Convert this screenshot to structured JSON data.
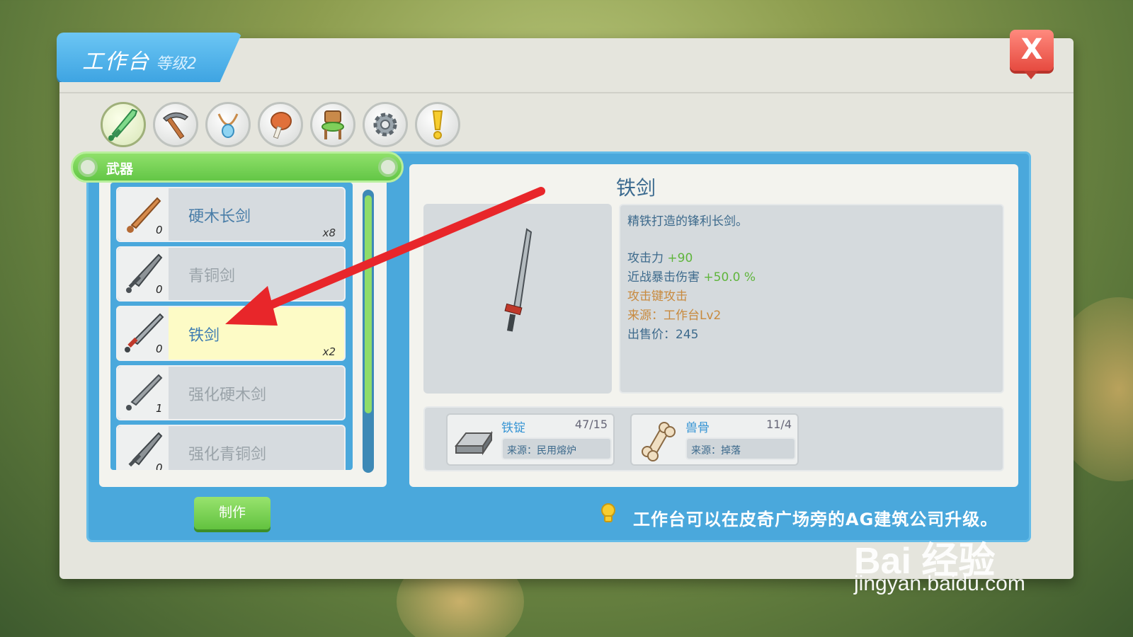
{
  "title": {
    "main": "工作台",
    "level": "等级2"
  },
  "close_label": "X",
  "categories": [
    "sword-icon",
    "pickaxe-icon",
    "necklace-icon",
    "meat-icon",
    "chair-icon",
    "gear-icon",
    "exclamation-icon"
  ],
  "category_bar": {
    "label": "武器"
  },
  "items": [
    {
      "name": "硬木长剑",
      "count": "0",
      "qty": "x8",
      "state": "normal"
    },
    {
      "name": "青铜剑",
      "count": "0",
      "qty": "",
      "state": "dim"
    },
    {
      "name": "铁剑",
      "count": "0",
      "qty": "x2",
      "state": "selected"
    },
    {
      "name": "强化硬木剑",
      "count": "1",
      "qty": "",
      "state": "dim"
    },
    {
      "name": "强化青铜剑",
      "count": "0",
      "qty": "",
      "state": "dim"
    }
  ],
  "make_button": "制作",
  "detail": {
    "name": "铁剑",
    "description": "精铁打造的锋利长剑。",
    "attack_label": "攻击力",
    "attack_value": "+90",
    "crit_label": "近战暴击伤害",
    "crit_value": "+50.0 %",
    "attack_key": "攻击键攻击",
    "source": "来源：工作台Lv2",
    "price": "出售价：245"
  },
  "materials": [
    {
      "name": "铁锭",
      "count": "47/15",
      "source": "来源：民用熔炉",
      "icon": "ingot-icon"
    },
    {
      "name": "兽骨",
      "count": "11/4",
      "source": "来源：掉落",
      "icon": "bone-icon"
    }
  ],
  "tip": "工作台可以在皮奇广场旁的AG建筑公司升级。",
  "watermark": {
    "logo": "Bai 经验",
    "url": "jingyan.baidu.com"
  },
  "colors": {
    "accent_blue": "#4aa8dc",
    "green": "#63c646",
    "close_red": "#e64a3f",
    "selected": "#fdfbc6",
    "arrow": "#e8262a"
  }
}
